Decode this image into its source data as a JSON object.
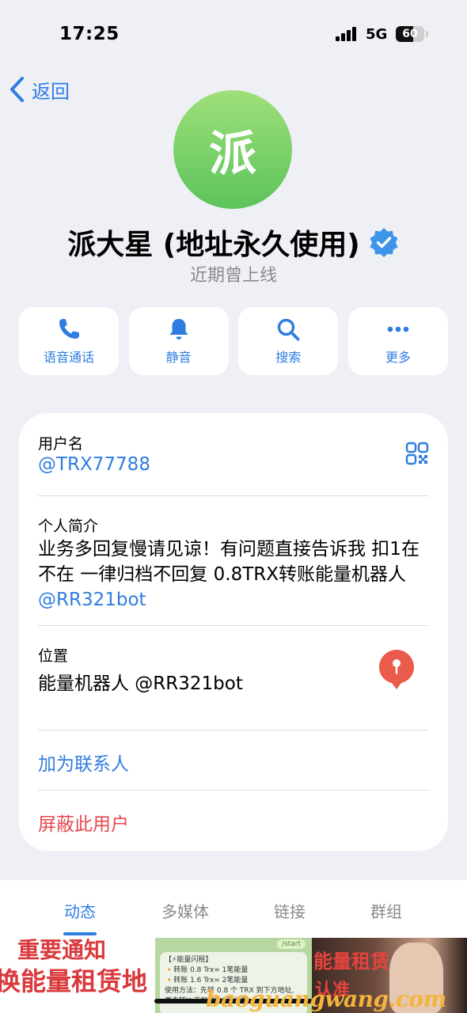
{
  "status": {
    "time": "17:25",
    "network": "5G",
    "battery": "60",
    "battery_level": 0.6
  },
  "nav": {
    "back_label": "返回"
  },
  "profile": {
    "avatar_char": "派",
    "avatar_colors": [
      "#9ee07a",
      "#5cc35b"
    ],
    "name": "派大星 (地址永久使用)",
    "verified_icon": "verified-badge-icon",
    "last_seen": "近期曾上线"
  },
  "actions": [
    {
      "label": "语音通话",
      "icon": "phone-icon"
    },
    {
      "label": "静音",
      "icon": "bell-icon"
    },
    {
      "label": "搜索",
      "icon": "search-icon"
    },
    {
      "label": "更多",
      "icon": "more-icon"
    }
  ],
  "info": {
    "username_label": "用户名",
    "username": "@TRX77788",
    "bio_label": "个人简介",
    "bio_text": "业务多回复慢请见谅！有问题直接告诉我 扣1在不在 一律归档不回复 0.8TRX转账能量机器人 ",
    "bio_link": "@RR321bot",
    "location_label": "位置",
    "location": "能量机器人 @RR321bot",
    "add_contact": "加为联系人",
    "block_user": "屏蔽此用户"
  },
  "tabs": [
    "动态",
    "多媒体",
    "链接",
    "群组"
  ],
  "active_tab": 0,
  "thumbs": {
    "t1_line1": "重要通知",
    "t1_line2": "换能量租赁地",
    "t2_start": "/start",
    "t2_lines": [
      "【⚡能量闪租】",
      "🔸转账 0.8 Trx= 1笔能量",
      "🔸转账 1.6 Trx= 2笔能量",
      "使用方法：先转 0.8 个 TRX 到下方地址,",
      "再去转U 不扣 TRX 手续费"
    ],
    "t3_line1": "能量租赁",
    "t3_line2": "认准"
  },
  "watermark": "baoguangwang.com",
  "colors": {
    "accent": "#2f7de1",
    "danger": "#e5484d",
    "background": "#eff0f5"
  }
}
